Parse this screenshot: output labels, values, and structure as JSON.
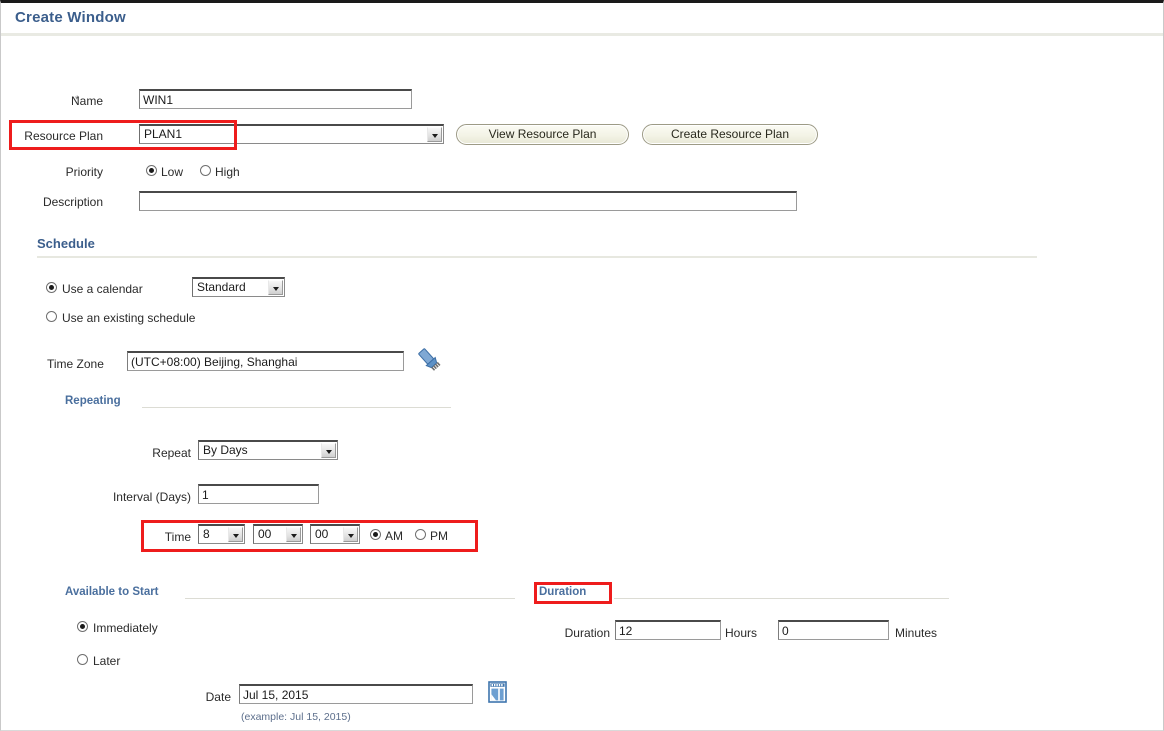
{
  "page": {
    "title": "Create Window"
  },
  "form": {
    "required_marker": "*",
    "name": {
      "label": "Name",
      "value": "WIN1",
      "placeholder": ""
    },
    "resource_plan": {
      "label": "Resource Plan",
      "value": "PLAN1",
      "options": [
        "PLAN1"
      ]
    },
    "buttons": {
      "view_resource_plan": "View Resource Plan",
      "create_resource_plan": "Create Resource Plan"
    },
    "priority": {
      "label": "Priority",
      "options": [
        "Low",
        "High"
      ],
      "selected": "Low"
    },
    "description": {
      "label": "Description",
      "value": "",
      "placeholder": ""
    }
  },
  "schedule": {
    "title": "Schedule",
    "mode": {
      "use_calendar_label": "Use a calendar",
      "use_existing_label": "Use an existing schedule",
      "selected": "Use a calendar",
      "calendar_value": "Standard",
      "calendar_options": [
        "Standard"
      ]
    },
    "time_zone": {
      "label": "Time Zone",
      "value": "(UTC+08:00) Beijing, Shanghai",
      "icon": "flashlight-icon"
    },
    "repeating": {
      "title": "Repeating",
      "repeat": {
        "label": "Repeat",
        "value": "By Days",
        "options": [
          "By Days"
        ]
      },
      "interval": {
        "label": "Interval (Days)",
        "value": "1"
      },
      "time": {
        "label": "Time",
        "hour": "8",
        "minute": "00",
        "second": "00",
        "hour_options": [
          "8"
        ],
        "minute_options": [
          "00"
        ],
        "second_options": [
          "00"
        ],
        "meridiem_options": [
          "AM",
          "PM"
        ],
        "meridiem_selected": "AM"
      }
    },
    "available_to_start": {
      "title": "Available to Start",
      "options": [
        "Immediately",
        "Later"
      ],
      "selected": "Immediately",
      "date": {
        "label": "Date",
        "value": "Jul 15, 2015",
        "hint": "(example: Jul 15, 2015)",
        "icon": "calendar-icon"
      }
    },
    "duration": {
      "title": "Duration",
      "label": "Duration",
      "hours_value": "12",
      "hours_label": "Hours",
      "minutes_value": "0",
      "minutes_label": "Minutes"
    }
  },
  "annotations": {
    "highlight_color": "#ee1c1c",
    "boxes": [
      "resource-plan-row",
      "time-row",
      "duration-section-title"
    ]
  },
  "colors": {
    "title_blue": "#3b5e8c",
    "section_blue": "#4a6f9e",
    "icon_blue": "#2f6fb5",
    "text": "#1b1b1b"
  }
}
